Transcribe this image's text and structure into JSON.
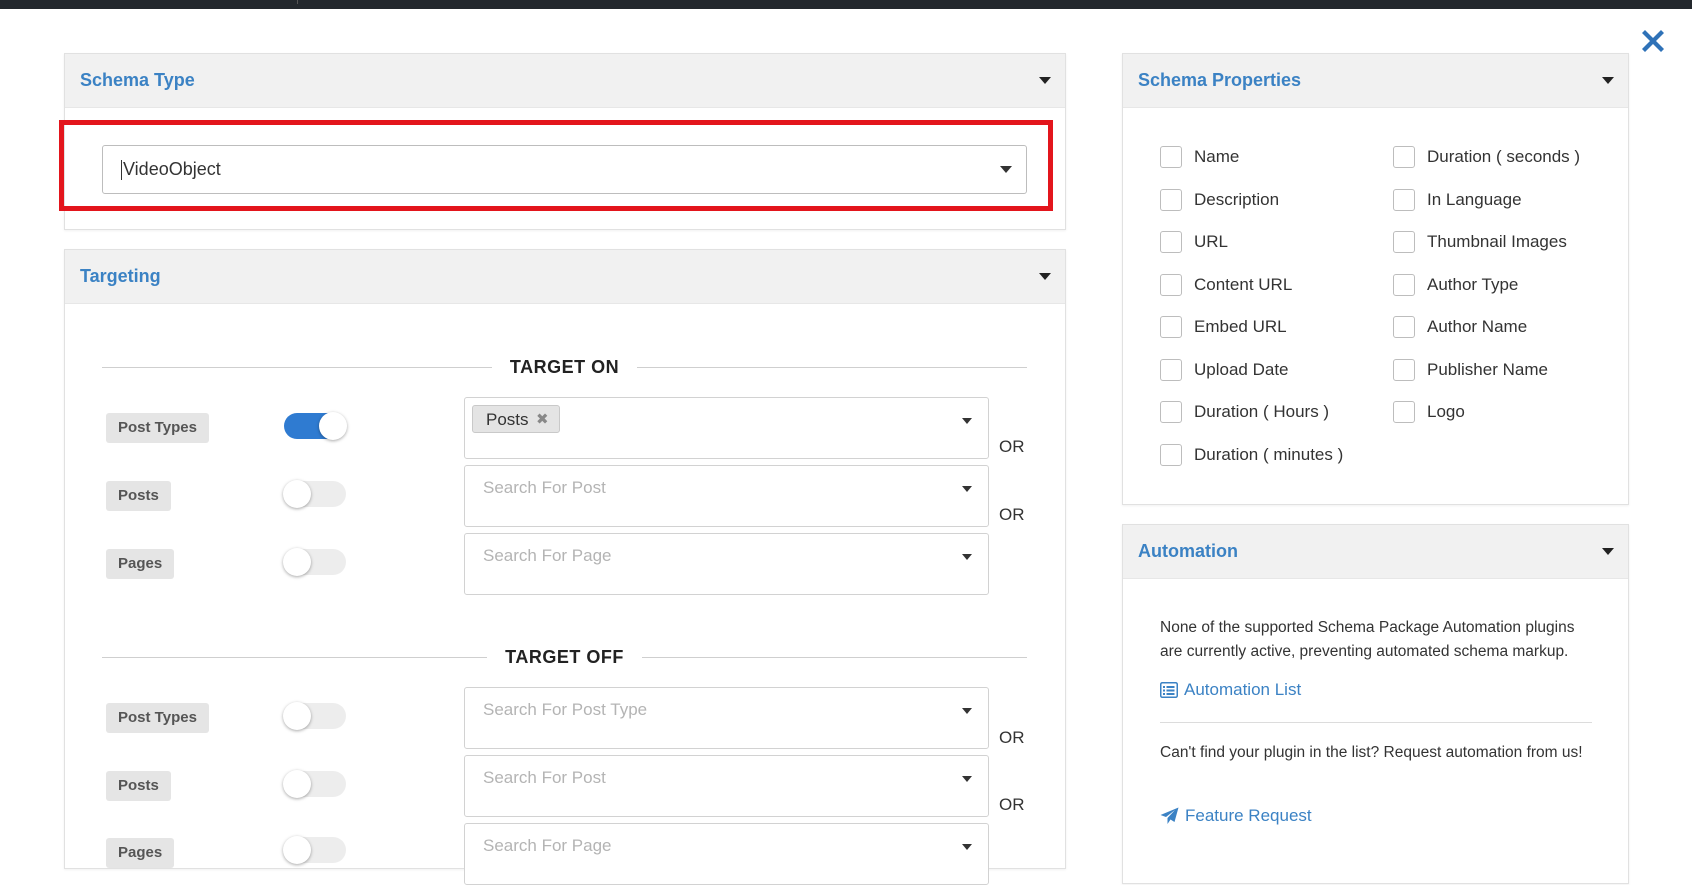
{
  "schema_type": {
    "title": "Schema Type",
    "selected": "VideoObject"
  },
  "targeting": {
    "title": "Targeting",
    "target_on": {
      "heading": "TARGET ON",
      "rows": [
        {
          "label": "Post Types",
          "enabled": true,
          "chip": "Posts",
          "or": "OR"
        },
        {
          "label": "Posts",
          "enabled": false,
          "placeholder": "Search For Post",
          "or": "OR"
        },
        {
          "label": "Pages",
          "enabled": false,
          "placeholder": "Search For Page"
        }
      ]
    },
    "target_off": {
      "heading": "TARGET OFF",
      "rows": [
        {
          "label": "Post Types",
          "enabled": false,
          "placeholder": "Search For Post Type",
          "or": "OR"
        },
        {
          "label": "Posts",
          "enabled": false,
          "placeholder": "Search For Post",
          "or": "OR"
        },
        {
          "label": "Pages",
          "enabled": false,
          "placeholder": "Search For Page"
        }
      ]
    }
  },
  "schema_properties": {
    "title": "Schema Properties",
    "left": [
      "Name",
      "Description",
      "URL",
      "Content URL",
      "Embed URL",
      "Upload Date",
      "Duration ( Hours )",
      "Duration ( minutes )"
    ],
    "right": [
      "Duration ( seconds )",
      "In Language",
      "Thumbnail Images",
      "Author Type",
      "Author Name",
      "Publisher Name",
      "Logo"
    ]
  },
  "automation": {
    "title": "Automation",
    "notice": "None of the supported Schema Package Automation plugins are currently active, preventing automated schema markup.",
    "list_link": "Automation List",
    "request_text": "Can't find your plugin in the list? Request automation from us!",
    "feature_link": "Feature Request"
  },
  "colors": {
    "accent": "#3b82c4",
    "toggle_on": "#2f7bd1",
    "highlight": "#e3151c"
  }
}
